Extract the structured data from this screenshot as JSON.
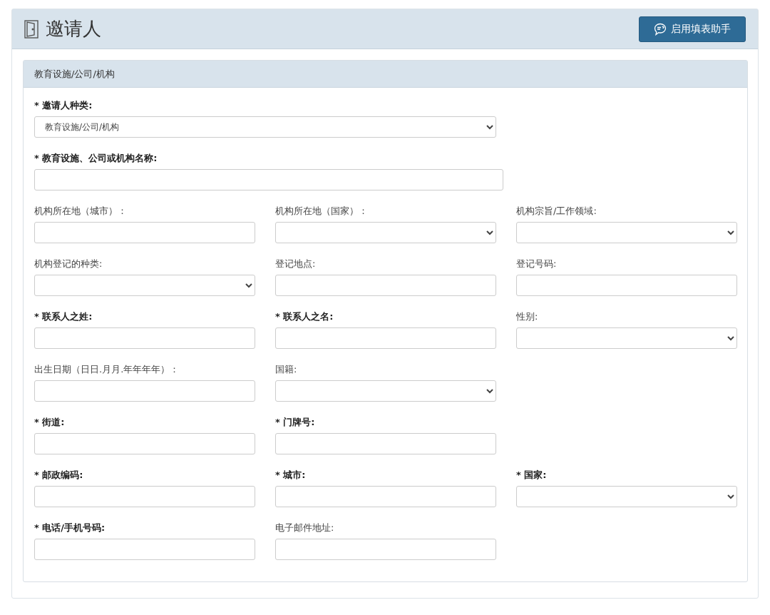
{
  "header": {
    "title": "邀请人",
    "assistant_button": "启用填表助手"
  },
  "section": {
    "title": "教育设施/公司/机构",
    "primary_fields": [
      {
        "label": "* 邀请人种类:",
        "required": true,
        "kind": "select",
        "value": "教育设施/公司/机构"
      },
      {
        "label": "* 教育设施、公司或机构名称:",
        "required": true,
        "kind": "text"
      }
    ],
    "rows": [
      [
        {
          "label": "机构所在地（城市）：",
          "required": false,
          "kind": "text"
        },
        {
          "label": "机构所在地（国家）：",
          "required": false,
          "kind": "select"
        },
        {
          "label": "机构宗旨/工作领域:",
          "required": false,
          "kind": "select"
        }
      ],
      [
        {
          "label": "机构登记的种类:",
          "required": false,
          "kind": "select"
        },
        {
          "label": "登记地点:",
          "required": false,
          "kind": "text"
        },
        {
          "label": "登记号码:",
          "required": false,
          "kind": "text"
        }
      ],
      [
        {
          "label": "* 联系人之姓:",
          "required": true,
          "kind": "text"
        },
        {
          "label": "* 联系人之名:",
          "required": true,
          "kind": "text"
        },
        {
          "label": "性别:",
          "required": false,
          "kind": "select"
        }
      ],
      [
        {
          "label": "出生日期（日日.月月.年年年年）：",
          "required": false,
          "kind": "text"
        },
        {
          "label": "国籍:",
          "required": false,
          "kind": "select"
        }
      ],
      [
        {
          "label": "* 街道:",
          "required": true,
          "kind": "text"
        },
        {
          "label": "* 门牌号:",
          "required": true,
          "kind": "text"
        }
      ],
      [
        {
          "label": "* 邮政编码:",
          "required": true,
          "kind": "text"
        },
        {
          "label": "* 城市:",
          "required": true,
          "kind": "text"
        },
        {
          "label": "* 国家:",
          "required": true,
          "kind": "select"
        }
      ],
      [
        {
          "label": "* 电话/手机号码:",
          "required": true,
          "kind": "text"
        },
        {
          "label": "电子邮件地址:",
          "required": false,
          "kind": "text"
        }
      ]
    ]
  }
}
